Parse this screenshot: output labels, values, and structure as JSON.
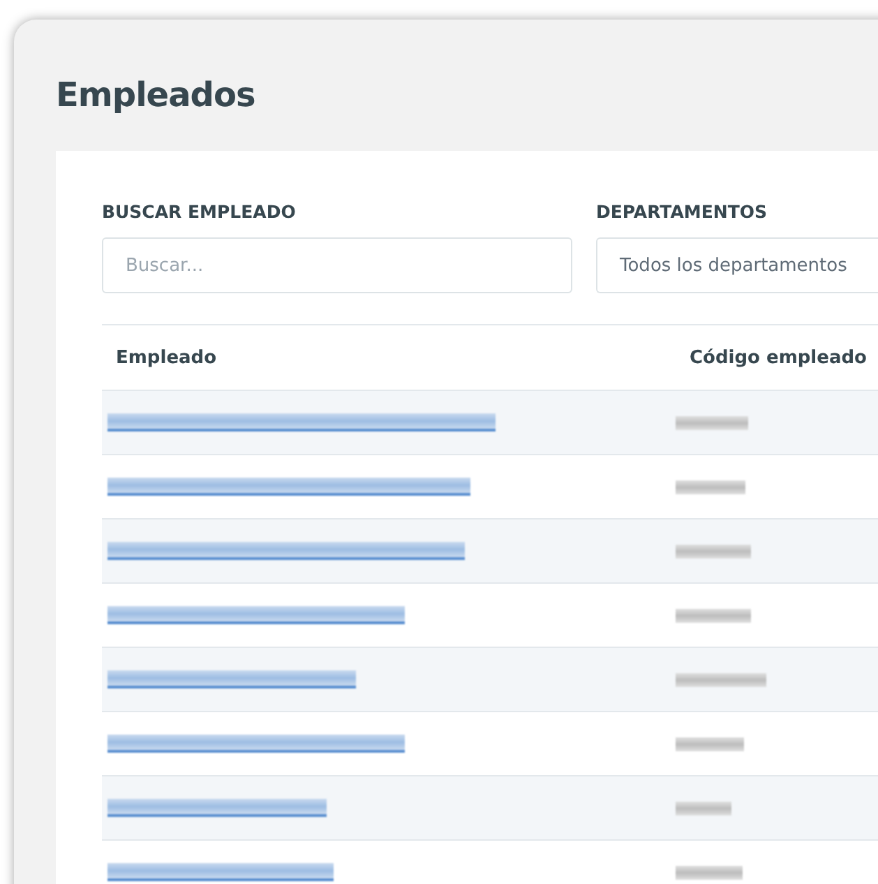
{
  "title": "Empleados",
  "filters": [
    {
      "kind": "search",
      "label": "BUSCAR EMPLEADO",
      "placeholder": "Buscar..."
    },
    {
      "kind": "select",
      "label": "DEPARTAMENTOS",
      "value": "Todos los departamentos"
    }
  ],
  "table": {
    "columns": [
      "Empleado",
      "Código empleado"
    ]
  }
}
